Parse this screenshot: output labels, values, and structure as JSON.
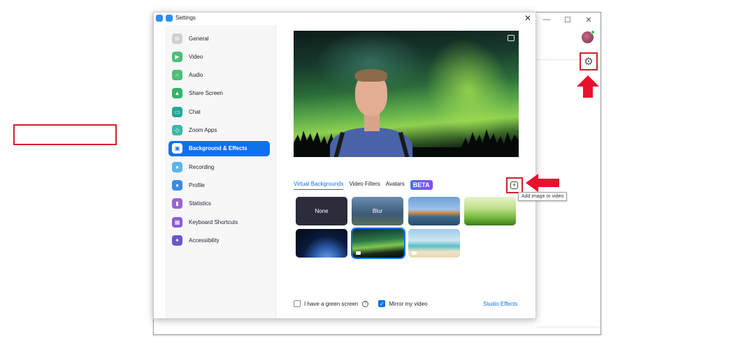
{
  "window": {
    "title": "Settings",
    "minimize": "—",
    "maximize": "☐",
    "close": "✕"
  },
  "sidebar": {
    "items": [
      {
        "label": "General",
        "icon": "gear-icon",
        "color": "#d0d0d0"
      },
      {
        "label": "Video",
        "icon": "video-icon",
        "color": "#4cbf77"
      },
      {
        "label": "Audio",
        "icon": "headphones-icon",
        "color": "#4cbf77"
      },
      {
        "label": "Share Screen",
        "icon": "share-screen-icon",
        "color": "#33b56a"
      },
      {
        "label": "Chat",
        "icon": "chat-icon",
        "color": "#25a89a"
      },
      {
        "label": "Zoom Apps",
        "icon": "apps-icon",
        "color": "#3fb8a8"
      },
      {
        "label": "Background & Effects",
        "icon": "person-frame-icon",
        "color": "#ffffff"
      },
      {
        "label": "Recording",
        "icon": "record-icon",
        "color": "#5ab6ea"
      },
      {
        "label": "Profile",
        "icon": "person-icon",
        "color": "#3d8be0"
      },
      {
        "label": "Statistics",
        "icon": "chart-icon",
        "color": "#9a63d6"
      },
      {
        "label": "Keyboard Shortcuts",
        "icon": "keyboard-icon",
        "color": "#8a5fd0"
      },
      {
        "label": "Accessibility",
        "icon": "accessibility-icon",
        "color": "#6a58c8"
      }
    ],
    "active_index": 6
  },
  "tabs": {
    "items": [
      "Virtual Backgrounds",
      "Video Filters",
      "Avatars"
    ],
    "beta": "BETA",
    "active": "Virtual Backgrounds"
  },
  "add_tooltip": "Add image or video",
  "thumbnails": [
    {
      "label": "None"
    },
    {
      "label": "Blur"
    },
    {
      "label": ""
    },
    {
      "label": ""
    },
    {
      "label": ""
    },
    {
      "label": ""
    },
    {
      "label": ""
    }
  ],
  "footer": {
    "green_screen": "I have a green screen",
    "green_screen_checked": false,
    "mirror": "Mirror my video",
    "mirror_checked": true,
    "studio_effects": "Studio Effects",
    "help_glyph": "?",
    "check_glyph": "✓"
  },
  "colors": {
    "accent": "#0e72ed",
    "highlight": "#d51f2a"
  }
}
